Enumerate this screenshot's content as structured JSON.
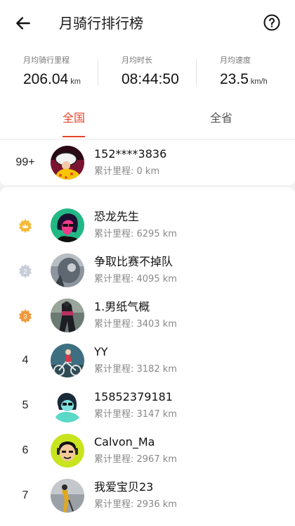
{
  "header": {
    "title": "月骑行排行榜"
  },
  "stats": [
    {
      "label": "月均骑行里程",
      "value": "206.04",
      "unit": "km"
    },
    {
      "label": "月均时长",
      "value": "08:44:50",
      "unit": ""
    },
    {
      "label": "月均速度",
      "value": "23.5",
      "unit": "km/h"
    }
  ],
  "tabs": [
    {
      "label": "全国",
      "active": true
    },
    {
      "label": "全省",
      "active": false
    }
  ],
  "my_rank": {
    "rank": "99+",
    "name": "152****3836",
    "distance": "累计里程: 0 km"
  },
  "rankings": [
    {
      "rank": "1",
      "name": "恐龙先生",
      "distance": "累计里程: 6295 km",
      "medal": "gold"
    },
    {
      "rank": "2",
      "name": "争取比赛不掉队",
      "distance": "累计里程: 4095 km",
      "medal": "silver"
    },
    {
      "rank": "3",
      "name": "1.男纸气概",
      "distance": "累计里程: 3403 km",
      "medal": "bronze"
    },
    {
      "rank": "4",
      "name": "YY",
      "distance": "累计里程: 3182 km"
    },
    {
      "rank": "5",
      "name": "15852379181",
      "distance": "累计里程: 3147 km"
    },
    {
      "rank": "6",
      "name": "Calvon_Ma",
      "distance": "累计里程: 2967 km"
    },
    {
      "rank": "7",
      "name": "我爱宝贝23",
      "distance": "累计里程: 2936 km"
    }
  ],
  "icons": {
    "back": "arrow-left-icon",
    "help": "question-circle-icon",
    "medal_gold": "#f5b935",
    "medal_silver": "#c8ced8",
    "medal_bronze": "#f09a3c"
  },
  "colors": {
    "accent": "#e8452c"
  }
}
